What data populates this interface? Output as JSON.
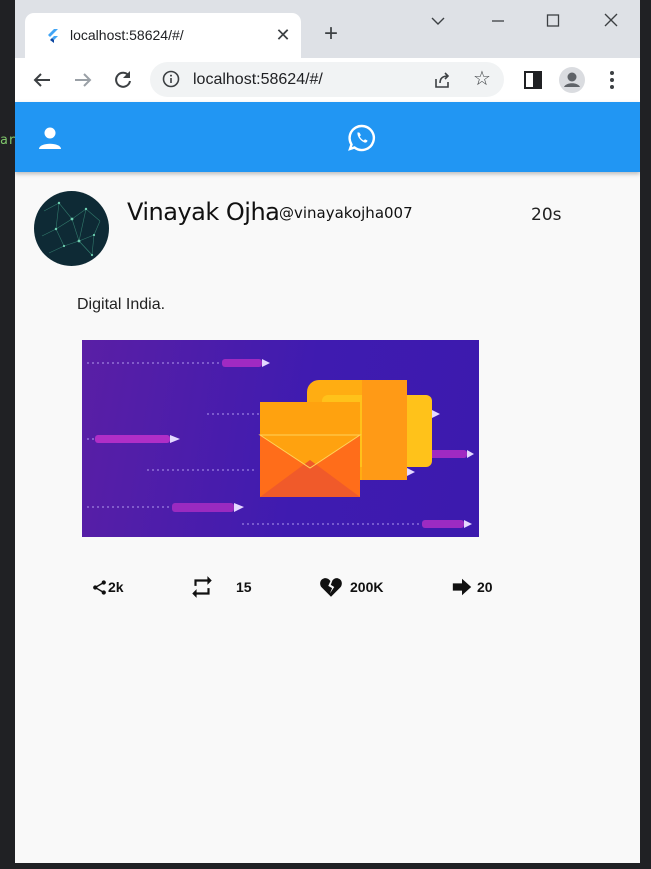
{
  "browser": {
    "tab_title": "localhost:58624/#/",
    "close_tab": "✕",
    "new_tab": "+",
    "url": "localhost:58624/#/"
  },
  "tweet": {
    "name": "Vinayak Ojha",
    "handle": "@vinayakojha007",
    "time": "20s",
    "text": "Digital India.",
    "actions": {
      "share_count": "2k",
      "retweet_count": "15",
      "like_count": "200K",
      "forward_count": "20"
    }
  },
  "colors": {
    "app_bar": "#2196f3",
    "page_bg": "#f9f9f9"
  },
  "icons": [
    "flutter-logo-icon",
    "close-icon",
    "plus-icon",
    "chevron-down-icon",
    "minimize-icon",
    "maximize-icon",
    "close-window-icon",
    "back-arrow-icon",
    "forward-arrow-icon",
    "reload-icon",
    "info-icon",
    "share-page-icon",
    "star-icon",
    "side-panel-icon",
    "profile-icon",
    "menu-dots-icon",
    "person-icon",
    "whatsapp-icon",
    "share-icon",
    "retweet-icon",
    "broken-heart-icon",
    "forward-arrow-icon"
  ]
}
